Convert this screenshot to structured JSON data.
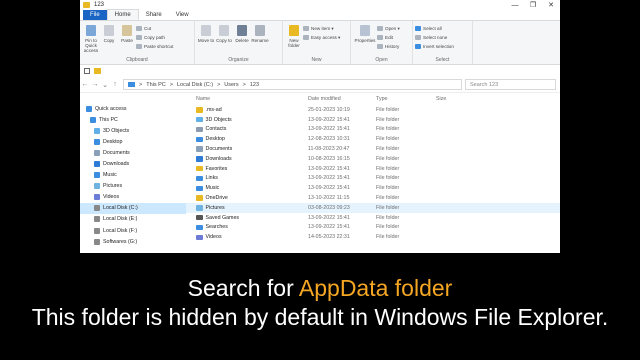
{
  "window": {
    "title": "123",
    "min": "—",
    "max": "❐",
    "close": "✕"
  },
  "tabs": [
    "File",
    "Home",
    "Share",
    "View"
  ],
  "ribbon": {
    "clipboard": {
      "label": "Clipboard",
      "pin": "Pin to Quick access",
      "copy": "Copy",
      "paste": "Paste",
      "cut": "Cut",
      "copy_path": "Copy path",
      "paste_shortcut": "Paste shortcut"
    },
    "organize": {
      "label": "Organize",
      "move_to": "Move to",
      "copy_to": "Copy to",
      "delete": "Delete",
      "rename": "Rename"
    },
    "new": {
      "label": "New",
      "new_folder": "New folder",
      "new_item": "New item ▾",
      "easy_access": "Easy access ▾"
    },
    "open": {
      "label": "Open",
      "properties": "Properties",
      "open": "Open ▾",
      "edit": "Edit",
      "history": "History"
    },
    "select": {
      "label": "Select",
      "select_all": "Select all",
      "select_none": "Select none",
      "invert": "Invert selection"
    }
  },
  "address": {
    "parts": [
      "This PC",
      ">",
      "Local Disk (C:)",
      ">",
      "Users",
      ">",
      "123"
    ],
    "search_placeholder": "Search 123"
  },
  "sidebar": [
    {
      "label": "Quick access",
      "icon": "star-icon",
      "color": "#3b8de0",
      "indent": 6
    },
    {
      "label": "This PC",
      "icon": "pc-icon",
      "color": "#3b8de0",
      "indent": 10
    },
    {
      "label": "3D Objects",
      "icon": "cube-icon",
      "color": "#5fb0e8",
      "indent": 14
    },
    {
      "label": "Desktop",
      "icon": "desktop-icon",
      "color": "#3b8de0",
      "indent": 14
    },
    {
      "label": "Documents",
      "icon": "documents-icon",
      "color": "#8aa0b8",
      "indent": 14
    },
    {
      "label": "Downloads",
      "icon": "downloads-icon",
      "color": "#2e7bd6",
      "indent": 14
    },
    {
      "label": "Music",
      "icon": "music-icon",
      "color": "#3b8de0",
      "indent": 14
    },
    {
      "label": "Pictures",
      "icon": "pictures-icon",
      "color": "#6fb3e0",
      "indent": 14
    },
    {
      "label": "Videos",
      "icon": "videos-icon",
      "color": "#6b7bd6",
      "indent": 14
    },
    {
      "label": "Local Disk (C:)",
      "icon": "drive-icon",
      "color": "#888888",
      "indent": 14,
      "selected": true
    },
    {
      "label": "Local Disk (E:)",
      "icon": "drive-icon",
      "color": "#888888",
      "indent": 14
    },
    {
      "label": "Local Disk (F:)",
      "icon": "drive-icon",
      "color": "#888888",
      "indent": 14
    },
    {
      "label": "Softwares (G:)",
      "icon": "drive-icon",
      "color": "#888888",
      "indent": 14
    }
  ],
  "columns": {
    "name": "Name",
    "date": "Date modified",
    "type": "Type",
    "size": "Size"
  },
  "files": [
    {
      "name": ".ms-ad",
      "date": "25-01-2023 10:19",
      "type": "File folder",
      "icon": "folder-icon",
      "color": "#e8b923"
    },
    {
      "name": "3D Objects",
      "date": "13-09-2022 15:41",
      "type": "File folder",
      "icon": "cube-icon",
      "color": "#5fb0e8"
    },
    {
      "name": "Contacts",
      "date": "13-09-2022 15:41",
      "type": "File folder",
      "icon": "contacts-icon",
      "color": "#8a9bb0"
    },
    {
      "name": "Desktop",
      "date": "12-08-2023 10:31",
      "type": "File folder",
      "icon": "desktop-icon",
      "color": "#3b8de0"
    },
    {
      "name": "Documents",
      "date": "11-08-2023 20:47",
      "type": "File folder",
      "icon": "documents-icon",
      "color": "#8aa0b8"
    },
    {
      "name": "Downloads",
      "date": "10-08-2023 16:15",
      "type": "File folder",
      "icon": "downloads-icon",
      "color": "#2e7bd6"
    },
    {
      "name": "Favorites",
      "date": "13-09-2022 15:41",
      "type": "File folder",
      "icon": "star-icon",
      "color": "#e8b923"
    },
    {
      "name": "Links",
      "date": "13-09-2022 15:41",
      "type": "File folder",
      "icon": "links-icon",
      "color": "#3b8de0"
    },
    {
      "name": "Music",
      "date": "13-09-2022 15:41",
      "type": "File folder",
      "icon": "music-icon",
      "color": "#3b8de0"
    },
    {
      "name": "OneDrive",
      "date": "13-10-2022 11:15",
      "type": "File folder",
      "icon": "folder-icon",
      "color": "#e8b923"
    },
    {
      "name": "Pictures",
      "date": "03-08-2023 09:23",
      "type": "File folder",
      "icon": "pictures-icon",
      "color": "#6fb3e0",
      "hover": true
    },
    {
      "name": "Saved Games",
      "date": "13-09-2022 15:41",
      "type": "File folder",
      "icon": "games-icon",
      "color": "#555555"
    },
    {
      "name": "Searches",
      "date": "13-09-2022 15:41",
      "type": "File folder",
      "icon": "search-icon",
      "color": "#3b8de0"
    },
    {
      "name": "Videos",
      "date": "14-05-2023 22:31",
      "type": "File folder",
      "icon": "videos-icon",
      "color": "#6b7bd6"
    }
  ],
  "caption": {
    "line1_prefix": "Search for ",
    "line1_highlight": "AppData folder",
    "line2": "This folder is hidden by default in Windows File Explorer."
  },
  "colors": {
    "accent": "#1a64c3",
    "highlight": "#f5a623",
    "selection": "#cce8ff"
  }
}
